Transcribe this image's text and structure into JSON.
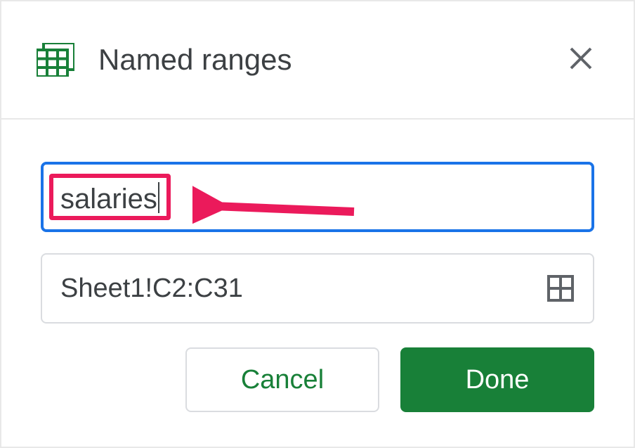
{
  "header": {
    "title": "Named ranges"
  },
  "inputs": {
    "name_value": "salaries",
    "range_value": "Sheet1!C2:C31"
  },
  "buttons": {
    "cancel_label": "Cancel",
    "done_label": "Done"
  },
  "colors": {
    "accent_blue": "#1a73e8",
    "highlight_pink": "#eb1a5b",
    "primary_green": "#188038",
    "sheets_green": "#188038"
  }
}
